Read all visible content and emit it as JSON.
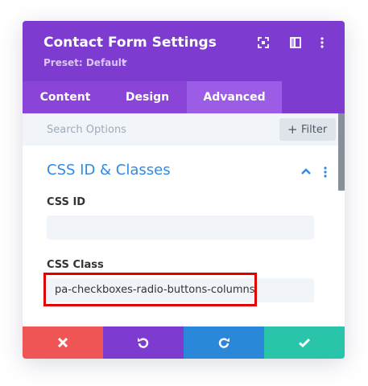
{
  "header": {
    "title": "Contact Form Settings",
    "preset": "Preset: Default",
    "icons": [
      "expand-icon",
      "sidebar-layout-icon",
      "more-vertical-icon"
    ]
  },
  "tabs": [
    {
      "label": "Content",
      "active": false
    },
    {
      "label": "Design",
      "active": false
    },
    {
      "label": "Advanced",
      "active": true
    }
  ],
  "search": {
    "placeholder": "Search Options",
    "filter_label": "Filter"
  },
  "section": {
    "title": "CSS ID & Classes",
    "fields": [
      {
        "label": "CSS ID",
        "value": ""
      },
      {
        "label": "CSS Class",
        "value": "pa-checkboxes-radio-buttons-columns"
      }
    ]
  },
  "footer": {
    "buttons": [
      {
        "name": "discard",
        "color": "#ef5555"
      },
      {
        "name": "undo",
        "color": "#7e3bd0"
      },
      {
        "name": "redo",
        "color": "#2b87da"
      },
      {
        "name": "save",
        "color": "#29c4a9"
      }
    ]
  },
  "colors": {
    "header_bg": "#7e3bd0",
    "accent_blue": "#2e8ae6",
    "highlight": "#e00000"
  }
}
